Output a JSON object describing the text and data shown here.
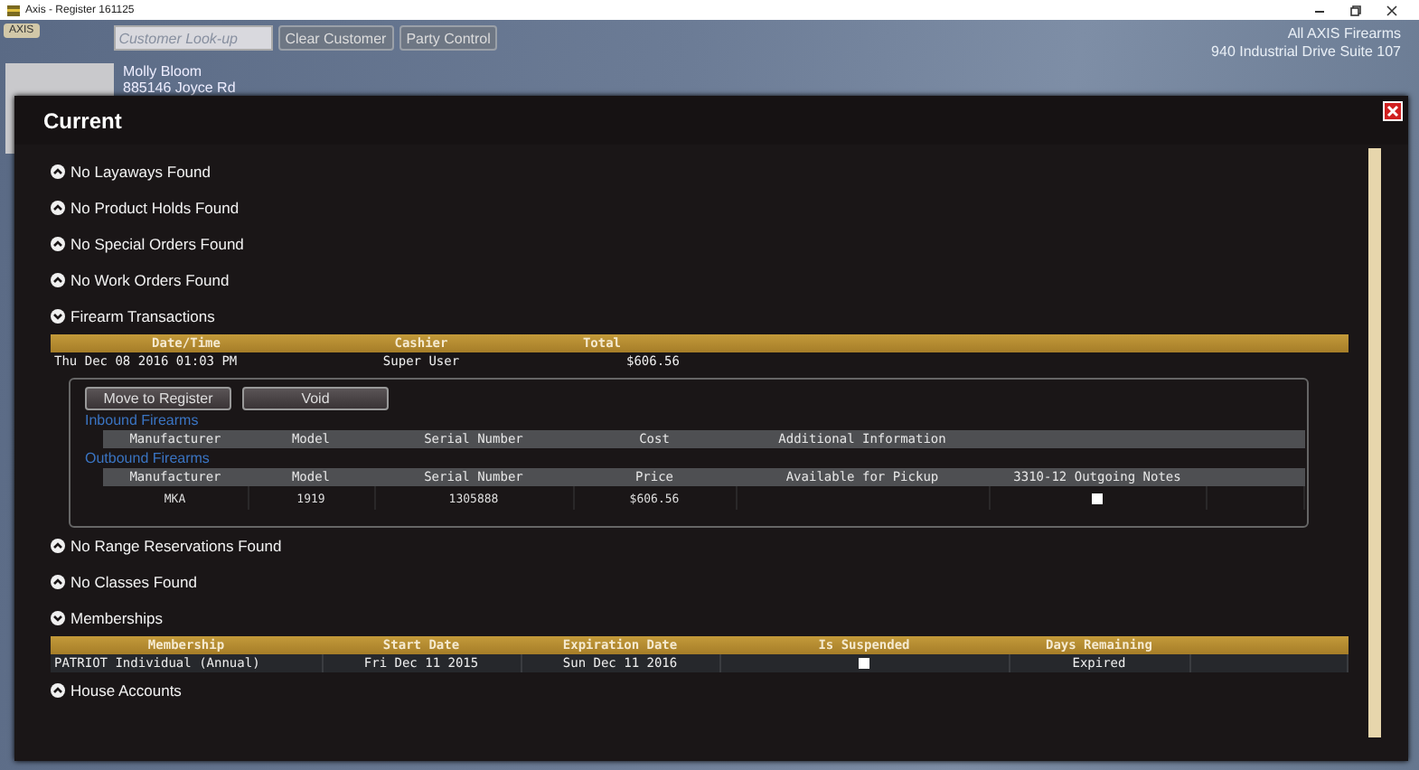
{
  "window": {
    "title": "Axis - Register 161125"
  },
  "app_button": "AXIS",
  "customer_lookup": {
    "placeholder": "Customer Look-up"
  },
  "header_buttons": [
    "Clear Customer",
    "Party Control"
  ],
  "customer": {
    "name": "Molly Bloom",
    "address": "885146 Joyce Rd"
  },
  "store": {
    "name": "All AXIS Firearms",
    "address": "940 Industrial Drive Suite 107"
  },
  "dialog": {
    "title": "Current",
    "sections": [
      {
        "kind": "empty",
        "label": "No Layaways Found",
        "expanded": false
      },
      {
        "kind": "empty",
        "label": "No Product Holds Found",
        "expanded": false
      },
      {
        "kind": "empty",
        "label": "No Special Orders Found",
        "expanded": false
      },
      {
        "kind": "empty",
        "label": "No Work Orders Found",
        "expanded": false
      },
      {
        "kind": "firearms",
        "label": "Firearm Transactions",
        "expanded": true,
        "table": {
          "columns": [
            "Date/Time",
            "Cashier",
            "Total"
          ],
          "rows": [
            [
              "Thu Dec 08 2016 01:03 PM",
              "Super User",
              "$606.56"
            ]
          ]
        },
        "detail": {
          "buttons": [
            "Move to Register",
            "Void"
          ],
          "inbound": {
            "title": "Inbound Firearms",
            "columns": [
              "Manufacturer",
              "Model",
              "Serial Number",
              "Cost",
              "Additional Information"
            ]
          },
          "outbound": {
            "title": "Outbound Firearms",
            "columns": [
              "Manufacturer",
              "Model",
              "Serial Number",
              "Price",
              "Available for Pickup",
              "3310-12 Outgoing Notes"
            ],
            "rows": [
              {
                "cells": [
                  "MKA",
                  "1919",
                  "1305888",
                  "$606.56"
                ],
                "checked": false
              }
            ]
          }
        }
      },
      {
        "kind": "empty",
        "label": "No Range Reservations Found",
        "expanded": false
      },
      {
        "kind": "empty",
        "label": "No Classes Found",
        "expanded": false
      },
      {
        "kind": "memberships",
        "label": "Memberships",
        "expanded": true,
        "table": {
          "columns": [
            "Membership",
            "Start Date",
            "Expiration Date",
            "Is Suspended",
            "Days Remaining"
          ],
          "rows": [
            {
              "cells": [
                "PATRIOT Individual (Annual)",
                "Fri Dec 11 2015",
                "Sun Dec 11 2016"
              ],
              "suspended": false,
              "days_remaining": "Expired"
            }
          ]
        }
      },
      {
        "kind": "empty",
        "label": "House Accounts",
        "expanded": false
      }
    ]
  }
}
